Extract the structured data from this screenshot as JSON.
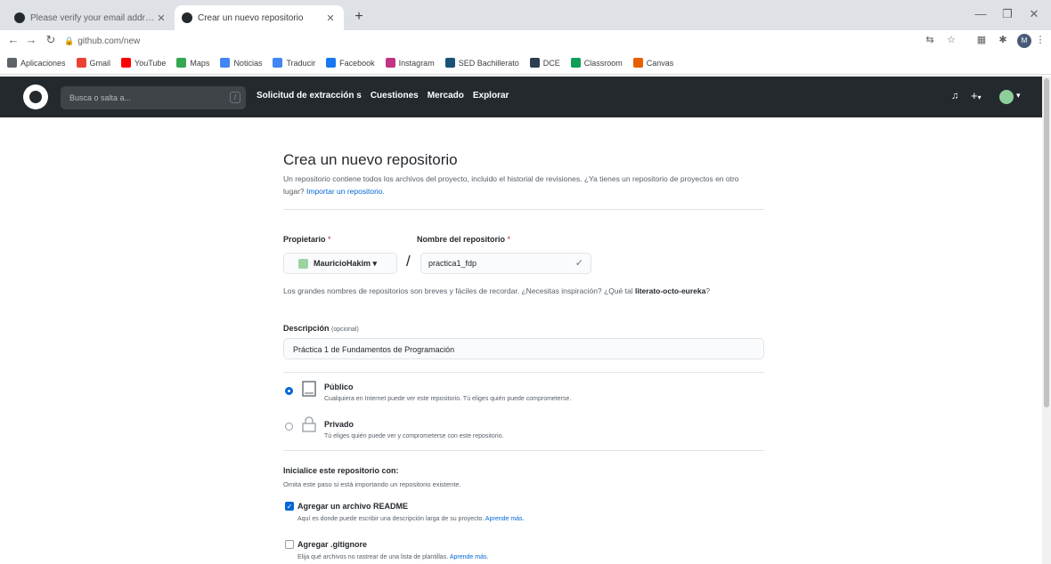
{
  "browser": {
    "tabs": [
      {
        "title": "Please verify your email address",
        "active": false
      },
      {
        "title": "Crear un nuevo repositorio",
        "active": true
      }
    ],
    "new_tab_glyph": "+",
    "url": "github.com/new",
    "profile_initial": "M",
    "bookmarks": [
      {
        "label": "Aplicaciones",
        "icon": "apps-grid-icon",
        "color": "#5f6368"
      },
      {
        "label": "Gmail",
        "icon": "gmail-icon",
        "color": "#ea4335"
      },
      {
        "label": "YouTube",
        "icon": "youtube-icon",
        "color": "#ff0000"
      },
      {
        "label": "Maps",
        "icon": "maps-icon",
        "color": "#34a853"
      },
      {
        "label": "Noticias",
        "icon": "news-icon",
        "color": "#4285f4"
      },
      {
        "label": "Traducir",
        "icon": "translate-icon",
        "color": "#4285f4"
      },
      {
        "label": "Facebook",
        "icon": "facebook-icon",
        "color": "#1877f2"
      },
      {
        "label": "Instagram",
        "icon": "instagram-icon",
        "color": "#c13584"
      },
      {
        "label": "SED Bachillerato",
        "icon": "sed-icon",
        "color": "#1a5276"
      },
      {
        "label": "DCE",
        "icon": "dce-icon",
        "color": "#2c3e50"
      },
      {
        "label": "Classroom",
        "icon": "classroom-icon",
        "color": "#0f9d58"
      },
      {
        "label": "Canvas",
        "icon": "canvas-icon",
        "color": "#e66000"
      }
    ]
  },
  "github": {
    "search_placeholder": "Busca o salta a...",
    "search_shortcut": "/",
    "nav": [
      "Solicitud de extracción s",
      "Cuestiones",
      "Mercado",
      "Explorar"
    ],
    "bell_glyph": "🔔",
    "plus_glyph": "+",
    "caret_glyph": "▾"
  },
  "form": {
    "title": "Crea un nuevo repositorio",
    "subtitle": "Un repositorio contiene todos los archivos del proyecto, incluido el historial de revisiones. ¿Ya tienes un repositorio de proyectos en otro lugar?",
    "import_link": "Importar un repositorio.",
    "owner_label": "Propietario",
    "required_mark": "*",
    "repo_label": "Nombre del repositorio",
    "owner_value": "MauricioHakim ▾",
    "separator": "/",
    "repo_value": "practica1_fdp",
    "check_glyph": "✓",
    "hint_text": "Los grandes nombres de repositorios son breves y fáciles de recordar. ¿Necesitas inspiración? ¿Qué tal",
    "hint_suggestion": "literato-octo-eureka",
    "hint_end": "?",
    "description_label": "Descripción",
    "optional_label": "(opcional)",
    "description_value": "Práctica 1 de Fundamentos de Programación",
    "public_title": "Público",
    "public_desc": "Cualquiera en Internet puede ver este repositorio. Tú eliges quién puede comprometerse.",
    "private_title": "Privado",
    "private_desc": "Tú eliges quién puede ver y comprometerse con este repositorio.",
    "init_label": "Inicialice este repositorio con:",
    "init_sub": "Omita este paso si está importando un repositorio existente.",
    "readme_label": "Agregar un archivo README",
    "readme_desc": "Aquí es donde puede escribir una descripción larga de su proyecto.",
    "learn_more": "Aprende más.",
    "gitignore_label": "Agregar .gitignore",
    "gitignore_desc": "Elija qué archivos no rastrear de una lista de plantillas.",
    "readme_checked": true,
    "gitignore_checked": false,
    "visibility_selected": "public"
  },
  "colors": {
    "header_bg": "#24292e",
    "link": "#0366d6",
    "avatar": "#8dcf9a"
  }
}
